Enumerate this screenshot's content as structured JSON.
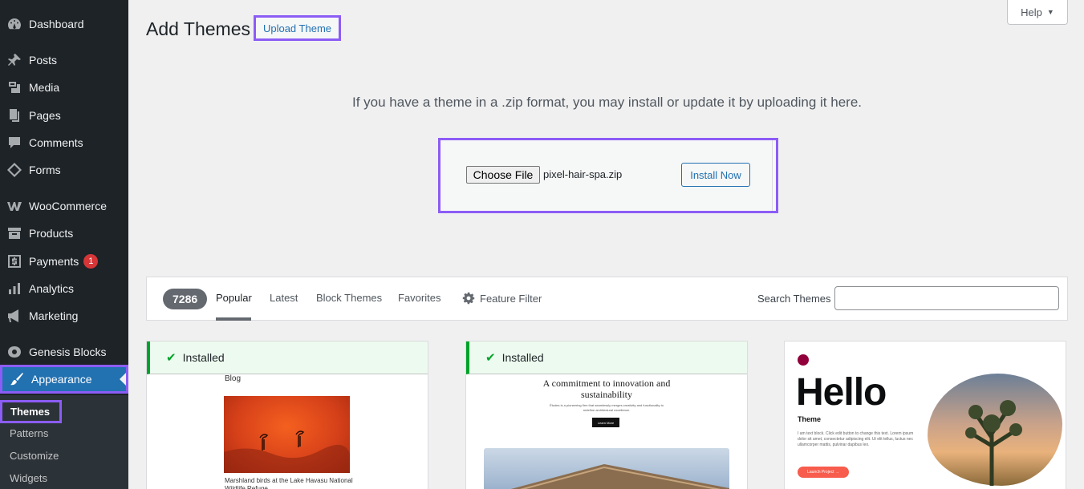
{
  "sidebar": {
    "items": [
      {
        "label": "Dashboard",
        "icon": "dashboard-icon"
      },
      {
        "label": "Posts",
        "icon": "pin-icon"
      },
      {
        "label": "Media",
        "icon": "media-icon"
      },
      {
        "label": "Pages",
        "icon": "pages-icon"
      },
      {
        "label": "Comments",
        "icon": "comment-icon"
      },
      {
        "label": "Forms",
        "icon": "forms-icon"
      },
      {
        "label": "WooCommerce",
        "icon": "woo-icon"
      },
      {
        "label": "Products",
        "icon": "archive-icon"
      },
      {
        "label": "Payments",
        "icon": "dollar-icon",
        "badge": "1"
      },
      {
        "label": "Analytics",
        "icon": "chart-bar-icon"
      },
      {
        "label": "Marketing",
        "icon": "megaphone-icon"
      },
      {
        "label": "Genesis Blocks",
        "icon": "genesis-icon"
      },
      {
        "label": "Appearance",
        "icon": "brush-icon"
      }
    ],
    "submenu": [
      "Themes",
      "Patterns",
      "Customize",
      "Widgets"
    ]
  },
  "header": {
    "title": "Add Themes",
    "upload_label": "Upload Theme",
    "help_label": "Help",
    "help_caret": "▼"
  },
  "upload": {
    "description": "If you have a theme in a .zip format, you may install or update it by uploading it here.",
    "choose_label": "Choose File",
    "file_name": "pixel-hair-spa.zip",
    "install_label": "Install Now"
  },
  "filter": {
    "count": "7286",
    "tabs": [
      "Popular",
      "Latest",
      "Block Themes",
      "Favorites"
    ],
    "feature_filter": "Feature Filter",
    "search_label": "Search Themes"
  },
  "cards": {
    "installed_label": "Installed",
    "check": "✔",
    "c1": {
      "heading": "Blog",
      "caption": "Marshland birds at the Lake Havasu National Wildlife Refuge"
    },
    "c2": {
      "title": "A commitment to innovation and sustainability",
      "sub": "Études is a pioneering firm that seamlessly merges creativity and functionality to redefine architectural excellence.",
      "button": "Learn More"
    },
    "c3": {
      "logo": "E",
      "hello": "Hello",
      "theme": "Theme",
      "text": "I am text block. Click edit button to change this text. Lorem ipsum dolor sit amet, consectetur adipiscing elit. Ut elit tellus, luctus nec ullamcorper mattis, pulvinar dapibus leo.",
      "button": "Launch Project →"
    }
  },
  "colors": {
    "accent": "#2271b1",
    "highlight": "#8c5cf6",
    "sidebar": "#1d2327",
    "installed": "#00a32a"
  }
}
